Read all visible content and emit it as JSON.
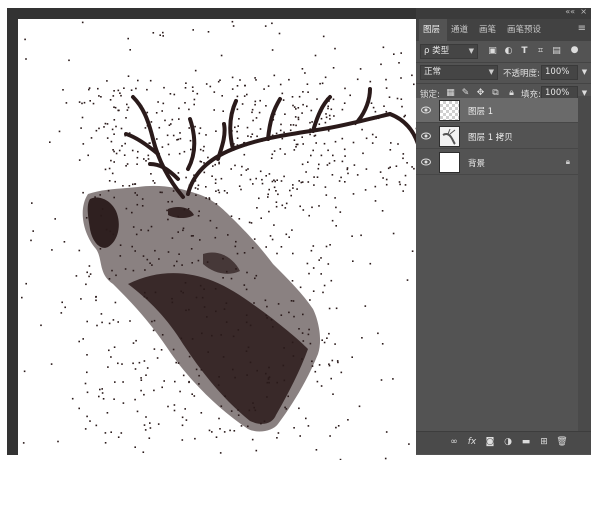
{
  "panel": {
    "tabs": [
      {
        "label": "图层",
        "active": true
      },
      {
        "label": "通道",
        "active": false
      },
      {
        "label": "画笔",
        "active": false
      },
      {
        "label": "画笔预设",
        "active": false
      }
    ],
    "filter": {
      "kind_label": "ρ 类型",
      "icons": [
        "image-filter-icon",
        "adjustment-filter-icon",
        "type-filter-icon",
        "shape-filter-icon",
        "smart-object-filter-icon",
        "filter-toggle-icon"
      ]
    },
    "blend_mode": "正常",
    "opacity_label": "不透明度:",
    "opacity_value": "100%",
    "lock_label": "锁定:",
    "fill_label": "填充:",
    "fill_value": "100%",
    "layers": [
      {
        "name": "图层 1",
        "selected": true,
        "visible": true,
        "locked": false
      },
      {
        "name": "图层 1 拷贝",
        "selected": false,
        "visible": true,
        "locked": false
      },
      {
        "name": "背景",
        "selected": false,
        "visible": true,
        "locked": true
      }
    ],
    "bottom_icons": [
      "link-icon",
      "fx-icon",
      "mask-icon",
      "adjustment-icon",
      "folder-icon",
      "new-layer-icon",
      "trash-icon"
    ],
    "fx_glyph": "fx",
    "accent_colors": {
      "panel_bg": "#535353",
      "selected_layer": "#6a6a6a"
    }
  }
}
